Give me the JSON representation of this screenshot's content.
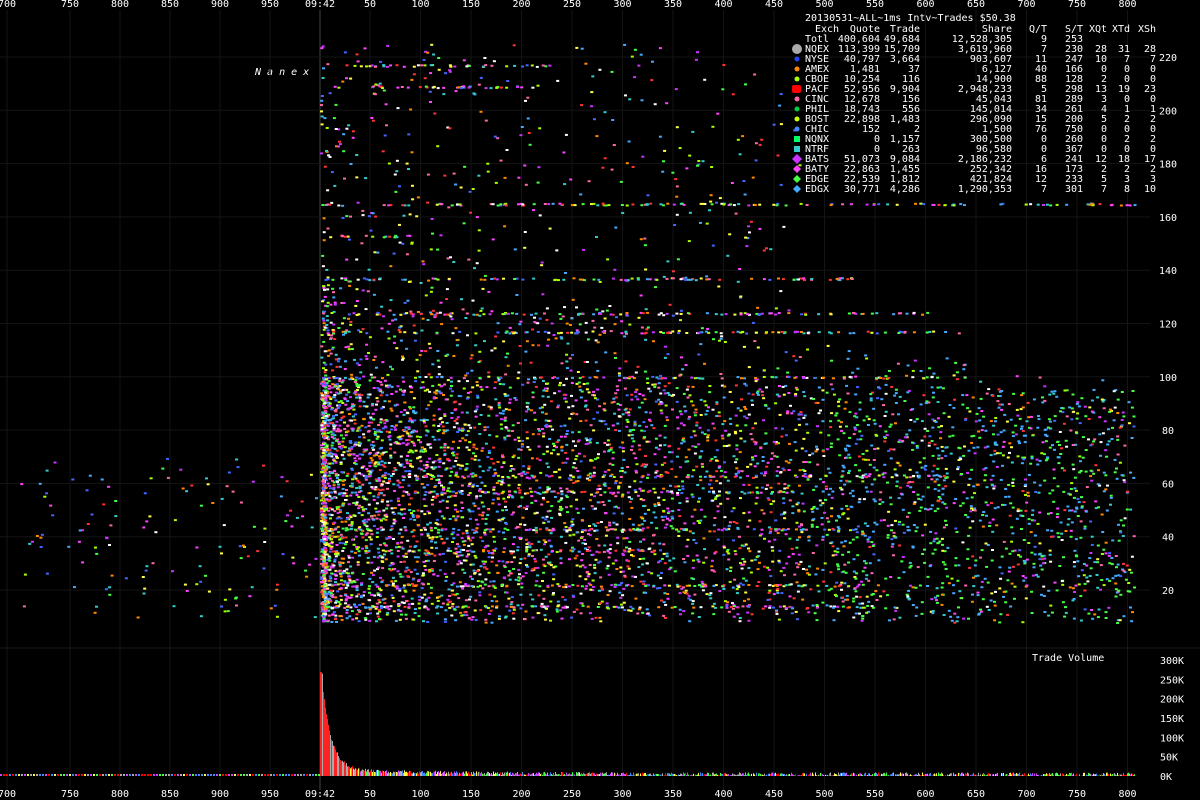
{
  "chart_data": {
    "type": "scatter",
    "title": "20130531~ALL~1ms Intv~Trades $50.38",
    "watermark": "N a n e x",
    "x_axis": {
      "ticks_pre": [
        "700",
        "750",
        "800",
        "850",
        "900",
        "950"
      ],
      "tick_open": "09:42",
      "ticks_post": [
        "50",
        "100",
        "150",
        "200",
        "250",
        "300",
        "350",
        "400",
        "450",
        "500",
        "550",
        "600",
        "650",
        "700",
        "750",
        "800"
      ]
    },
    "y_axis": {
      "ticks": [
        20,
        40,
        60,
        80,
        100,
        120,
        140,
        160,
        180,
        200,
        220
      ],
      "range": [
        5,
        230
      ]
    },
    "volume": {
      "label": "Trade Volume",
      "ticks": [
        "0K",
        "50K",
        "100K",
        "150K",
        "200K",
        "250K",
        "300K"
      ],
      "range": [
        0,
        300000
      ],
      "colors": [
        "#ff0000",
        "#aaaaaa",
        "#4488ff",
        "#cc44ff",
        "#44ff44",
        "#ffff44"
      ]
    },
    "legend": {
      "headers": [
        "Exch",
        "Quote",
        "Trade",
        "Share",
        "Q/T",
        "S/T",
        "XQt",
        "XTd",
        "XSh"
      ],
      "rows": [
        {
          "exch": "Totl",
          "quote": "400,604",
          "trade": "49,684",
          "share": "12,528,305",
          "qt": "9",
          "st": "253",
          "xqt": "",
          "xtd": "",
          "xsh": "",
          "color": ""
        },
        {
          "exch": "NQEX",
          "quote": "113,399",
          "trade": "15,709",
          "share": "3,619,960",
          "qt": "7",
          "st": "230",
          "xqt": "28",
          "xtd": "31",
          "xsh": "28",
          "color": "#aaaaaa",
          "marker": "circle-large"
        },
        {
          "exch": "NYSE",
          "quote": "40,797",
          "trade": "3,664",
          "share": "903,607",
          "qt": "11",
          "st": "247",
          "xqt": "10",
          "xtd": "7",
          "xsh": "7",
          "color": "#2244ff",
          "marker": "circle"
        },
        {
          "exch": "AMEX",
          "quote": "1,481",
          "trade": "37",
          "share": "6,127",
          "qt": "40",
          "st": "166",
          "xqt": "0",
          "xtd": "0",
          "xsh": "0",
          "color": "#ff8800",
          "marker": "circle"
        },
        {
          "exch": "CBOE",
          "quote": "10,254",
          "trade": "116",
          "share": "14,900",
          "qt": "88",
          "st": "128",
          "xqt": "2",
          "xtd": "0",
          "xsh": "0",
          "color": "#aaff00",
          "marker": "circle"
        },
        {
          "exch": "PACF",
          "quote": "52,956",
          "trade": "9,904",
          "share": "2,948,233",
          "qt": "5",
          "st": "298",
          "xqt": "13",
          "xtd": "19",
          "xsh": "23",
          "color": "#ff0000",
          "marker": "square-large"
        },
        {
          "exch": "CINC",
          "quote": "12,678",
          "trade": "156",
          "share": "45,043",
          "qt": "81",
          "st": "289",
          "xqt": "3",
          "xtd": "0",
          "xsh": "0",
          "color": "#ff66aa",
          "marker": "circle"
        },
        {
          "exch": "PHIL",
          "quote": "18,743",
          "trade": "556",
          "share": "145,014",
          "qt": "34",
          "st": "261",
          "xqt": "4",
          "xtd": "1",
          "xsh": "1",
          "color": "#00cc44",
          "marker": "circle"
        },
        {
          "exch": "BOST",
          "quote": "22,898",
          "trade": "1,483",
          "share": "296,090",
          "qt": "15",
          "st": "200",
          "xqt": "5",
          "xtd": "2",
          "xsh": "2",
          "color": "#ccff00",
          "marker": "circle"
        },
        {
          "exch": "CHIC",
          "quote": "152",
          "trade": "2",
          "share": "1,500",
          "qt": "76",
          "st": "750",
          "xqt": "0",
          "xtd": "0",
          "xsh": "0",
          "color": "#4488ff",
          "marker": "circle"
        },
        {
          "exch": "NQNX",
          "quote": "0",
          "trade": "1,157",
          "share": "300,500",
          "qt": "0",
          "st": "260",
          "xqt": "0",
          "xtd": "2",
          "xsh": "2",
          "color": "#00ff66",
          "marker": "square"
        },
        {
          "exch": "NTRF",
          "quote": "0",
          "trade": "263",
          "share": "96,580",
          "qt": "0",
          "st": "367",
          "xqt": "0",
          "xtd": "0",
          "xsh": "0",
          "color": "#33cccc",
          "marker": "square"
        },
        {
          "exch": "BATS",
          "quote": "51,073",
          "trade": "9,084",
          "share": "2,186,232",
          "qt": "6",
          "st": "241",
          "xqt": "12",
          "xtd": "18",
          "xsh": "17",
          "color": "#cc33ff",
          "marker": "diamond-large"
        },
        {
          "exch": "BATY",
          "quote": "22,863",
          "trade": "1,455",
          "share": "252,342",
          "qt": "16",
          "st": "173",
          "xqt": "2",
          "xtd": "2",
          "xsh": "2",
          "color": "#ff44ff",
          "marker": "diamond"
        },
        {
          "exch": "EDGE",
          "quote": "22,539",
          "trade": "1,812",
          "share": "421,824",
          "qt": "12",
          "st": "233",
          "xqt": "5",
          "xtd": "3",
          "xsh": "3",
          "color": "#44ff44",
          "marker": "diamond"
        },
        {
          "exch": "EDGX",
          "quote": "30,771",
          "trade": "4,286",
          "share": "1,290,353",
          "qt": "7",
          "st": "301",
          "xqt": "7",
          "xtd": "8",
          "xsh": "10",
          "color": "#44aaff",
          "marker": "diamond"
        }
      ]
    },
    "series_colors": [
      "#ff3333",
      "#cc33ff",
      "#ff44ff",
      "#44aaff",
      "#4466ff",
      "#44ff44",
      "#ffff44",
      "#ff8800",
      "#ffffff",
      "#33cccc",
      "#aaff00",
      "#ff66aa"
    ],
    "price_levels": [
      14,
      22,
      35,
      43,
      57,
      63,
      80,
      100,
      117,
      124,
      137,
      153,
      165,
      209,
      217
    ]
  }
}
